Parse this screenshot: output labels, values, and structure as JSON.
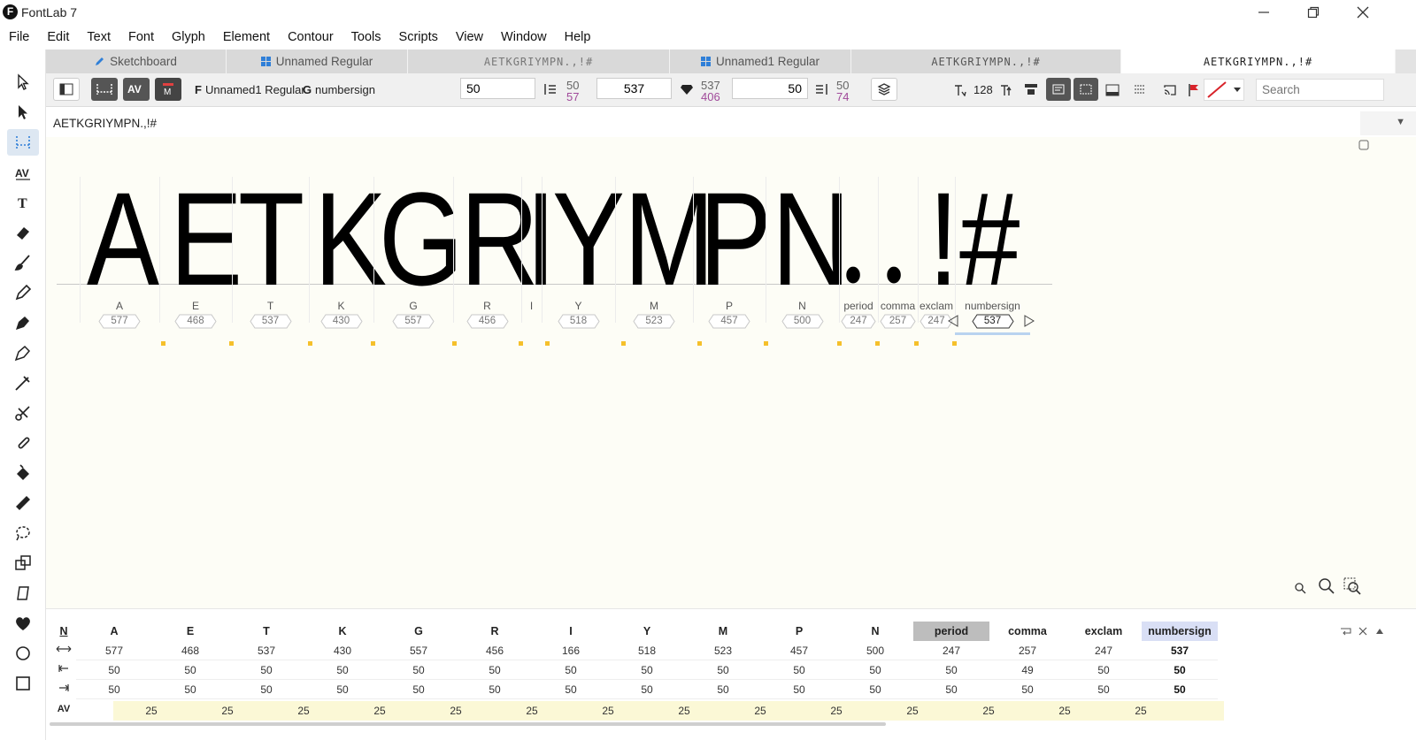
{
  "app": {
    "title": "FontLab 7",
    "logo": "F"
  },
  "menu": [
    "File",
    "Edit",
    "Text",
    "Font",
    "Glyph",
    "Element",
    "Contour",
    "Tools",
    "Scripts",
    "View",
    "Window",
    "Help"
  ],
  "tabs": [
    {
      "label": "Sketchboard",
      "icon": "pen-icon"
    },
    {
      "label": "Unnamed Regular",
      "icon": "grid-icon"
    },
    {
      "label": "AETKGRIYMPN.,!#",
      "icon": "",
      "preview": true
    },
    {
      "label": "Unnamed1 Regular",
      "icon": "grid-icon"
    },
    {
      "label": "AETKGRIYMPN.,!#",
      "icon": "",
      "preview": true
    },
    {
      "label": "AETKGRIYMPN.,!#",
      "icon": "",
      "preview": true,
      "active": true
    }
  ],
  "propbar": {
    "font_prefix": "F",
    "font_name": "Unnamed1 Regular",
    "glyph_prefix": "G",
    "glyph_name": "numbersign",
    "lsb_value": "50",
    "lsb_top": "50",
    "lsb_bottom": "57",
    "width_value": "537",
    "width_top": "537",
    "width_bottom": "406",
    "rsb_value": "50",
    "rsb_top": "50",
    "rsb_bottom": "74",
    "size_value": "128",
    "search_placeholder": "Search"
  },
  "text_input": "AETKGRIYMPN.,!#",
  "glyphs": [
    {
      "char": "A",
      "name": "A",
      "width": "577"
    },
    {
      "char": "E",
      "name": "E",
      "width": "468"
    },
    {
      "char": "T",
      "name": "T",
      "width": "537"
    },
    {
      "char": "K",
      "name": "K",
      "width": "430"
    },
    {
      "char": "G",
      "name": "G",
      "width": "557"
    },
    {
      "char": "R",
      "name": "R",
      "width": "456"
    },
    {
      "char": "I",
      "name": "I",
      "width": ""
    },
    {
      "char": "Y",
      "name": "Y",
      "width": "518"
    },
    {
      "char": "M",
      "name": "M",
      "width": "523"
    },
    {
      "char": "P",
      "name": "P",
      "width": "457"
    },
    {
      "char": "N",
      "name": "N",
      "width": "500"
    },
    {
      "char": "•",
      "name": "period",
      "width": "247"
    },
    {
      "char": "•",
      "name": "comma",
      "width": "257"
    },
    {
      "char": "!",
      "name": "exclam",
      "width": "247"
    },
    {
      "char": "#",
      "name": "numbersign",
      "width": "537"
    }
  ],
  "metrics": {
    "corner_label": "N",
    "row_labels": [
      "width-icon",
      "lsb-icon",
      "rsb-icon",
      "kern-icon"
    ],
    "kern_label": "AV",
    "columns": [
      {
        "name": "A",
        "width": "577",
        "lsb": "50",
        "rsb": "50"
      },
      {
        "name": "E",
        "width": "468",
        "lsb": "50",
        "rsb": "50"
      },
      {
        "name": "T",
        "width": "537",
        "lsb": "50",
        "rsb": "50"
      },
      {
        "name": "K",
        "width": "430",
        "lsb": "50",
        "rsb": "50"
      },
      {
        "name": "G",
        "width": "557",
        "lsb": "50",
        "rsb": "50"
      },
      {
        "name": "R",
        "width": "456",
        "lsb": "50",
        "rsb": "50"
      },
      {
        "name": "I",
        "width": "166",
        "lsb": "50",
        "rsb": "50"
      },
      {
        "name": "Y",
        "width": "518",
        "lsb": "50",
        "rsb": "50"
      },
      {
        "name": "M",
        "width": "523",
        "lsb": "50",
        "rsb": "50"
      },
      {
        "name": "P",
        "width": "457",
        "lsb": "50",
        "rsb": "50"
      },
      {
        "name": "N",
        "width": "500",
        "lsb": "50",
        "rsb": "50"
      },
      {
        "name": "period",
        "width": "247",
        "lsb": "50",
        "rsb": "50",
        "highlight": "grey"
      },
      {
        "name": "comma",
        "width": "257",
        "lsb": "49",
        "rsb": "50"
      },
      {
        "name": "exclam",
        "width": "247",
        "lsb": "50",
        "rsb": "50"
      },
      {
        "name": "numbersign",
        "width": "537",
        "lsb": "50",
        "rsb": "50",
        "highlight": "blue",
        "bold": true
      }
    ],
    "kerning": [
      "25",
      "25",
      "25",
      "25",
      "25",
      "25",
      "25",
      "25",
      "25",
      "25",
      "25",
      "25",
      "25",
      "25"
    ]
  },
  "colors": {
    "accent": "#2f7fd8",
    "marker": "#f5c02b",
    "canvas_bg": "#fdfdf6",
    "metric_purple": "#a04a9a"
  }
}
